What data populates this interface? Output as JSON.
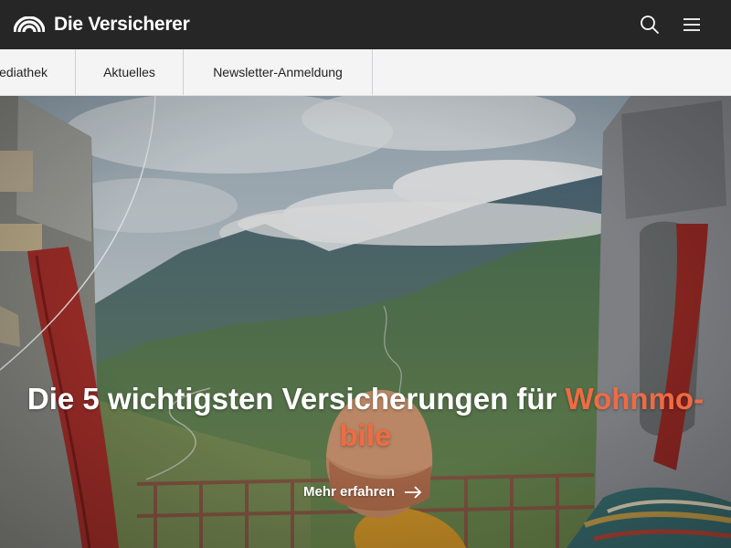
{
  "header": {
    "brand": "Die Versicherer",
    "icons": {
      "search": "search-icon",
      "menu": "menu-icon"
    }
  },
  "subnav": {
    "items": [
      {
        "label": "ediathek"
      },
      {
        "label": "Aktuelles"
      },
      {
        "label": "Newsletter-Anmeldung"
      }
    ]
  },
  "hero": {
    "title_main": "Die 5 wichtigsten Versicherungen für ",
    "title_accent_1": "Wohnmo-",
    "title_accent_2": "bile",
    "cta_label": "Mehr erfahren",
    "cta_icon": "arrow-right-icon"
  },
  "colors": {
    "header_bg": "#262626",
    "nav_bg": "#f4f4f4",
    "accent": "#ef6b43"
  }
}
